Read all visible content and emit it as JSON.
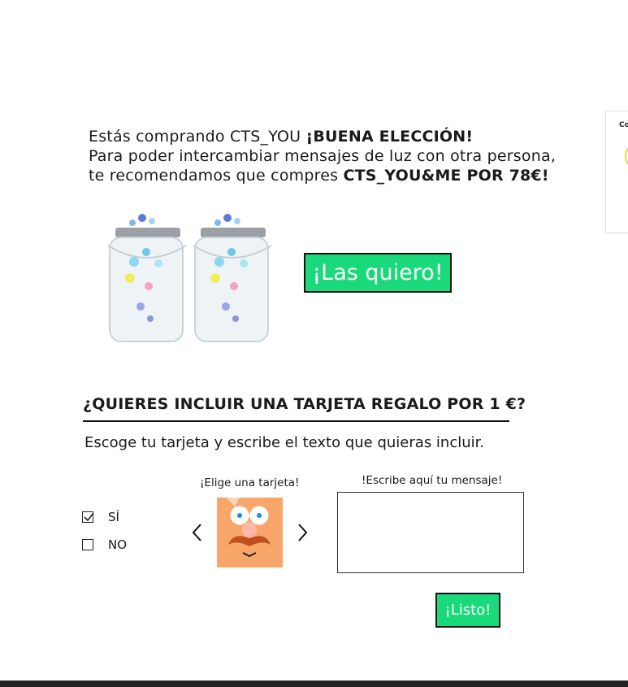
{
  "offer": {
    "line1_prefix": "Estás comprando CTS_YOU ",
    "line1_strong": "¡BUENA ELECCIÓN!",
    "line2": "Para poder intercambiar mensajes de luz con otra persona,",
    "line3_prefix": "te recomendamos que compres ",
    "line3_strong": "CTS_YOU&ME POR 78€!",
    "cta_label": "¡Las quiero!"
  },
  "gift_card": {
    "title": "¿QUIERES INCLUIR UNA TARJETA REGALO POR 1 €?",
    "subtitle": "Escoge tu tarjeta y escribe el texto que quieras incluir.",
    "options": [
      {
        "label": "SÍ",
        "checked": true
      },
      {
        "label": "NO",
        "checked": false
      }
    ],
    "card_picker_label": "¡Elige una tarjeta!",
    "message_label": "!Escribe aquí tu mensaje!",
    "message_value": "",
    "submit_label": "¡Listo!"
  },
  "side_panel": {
    "label": "Co"
  },
  "colors": {
    "accent": "#19d97a",
    "card_background": "#f8a66a",
    "footer": "#222222"
  }
}
